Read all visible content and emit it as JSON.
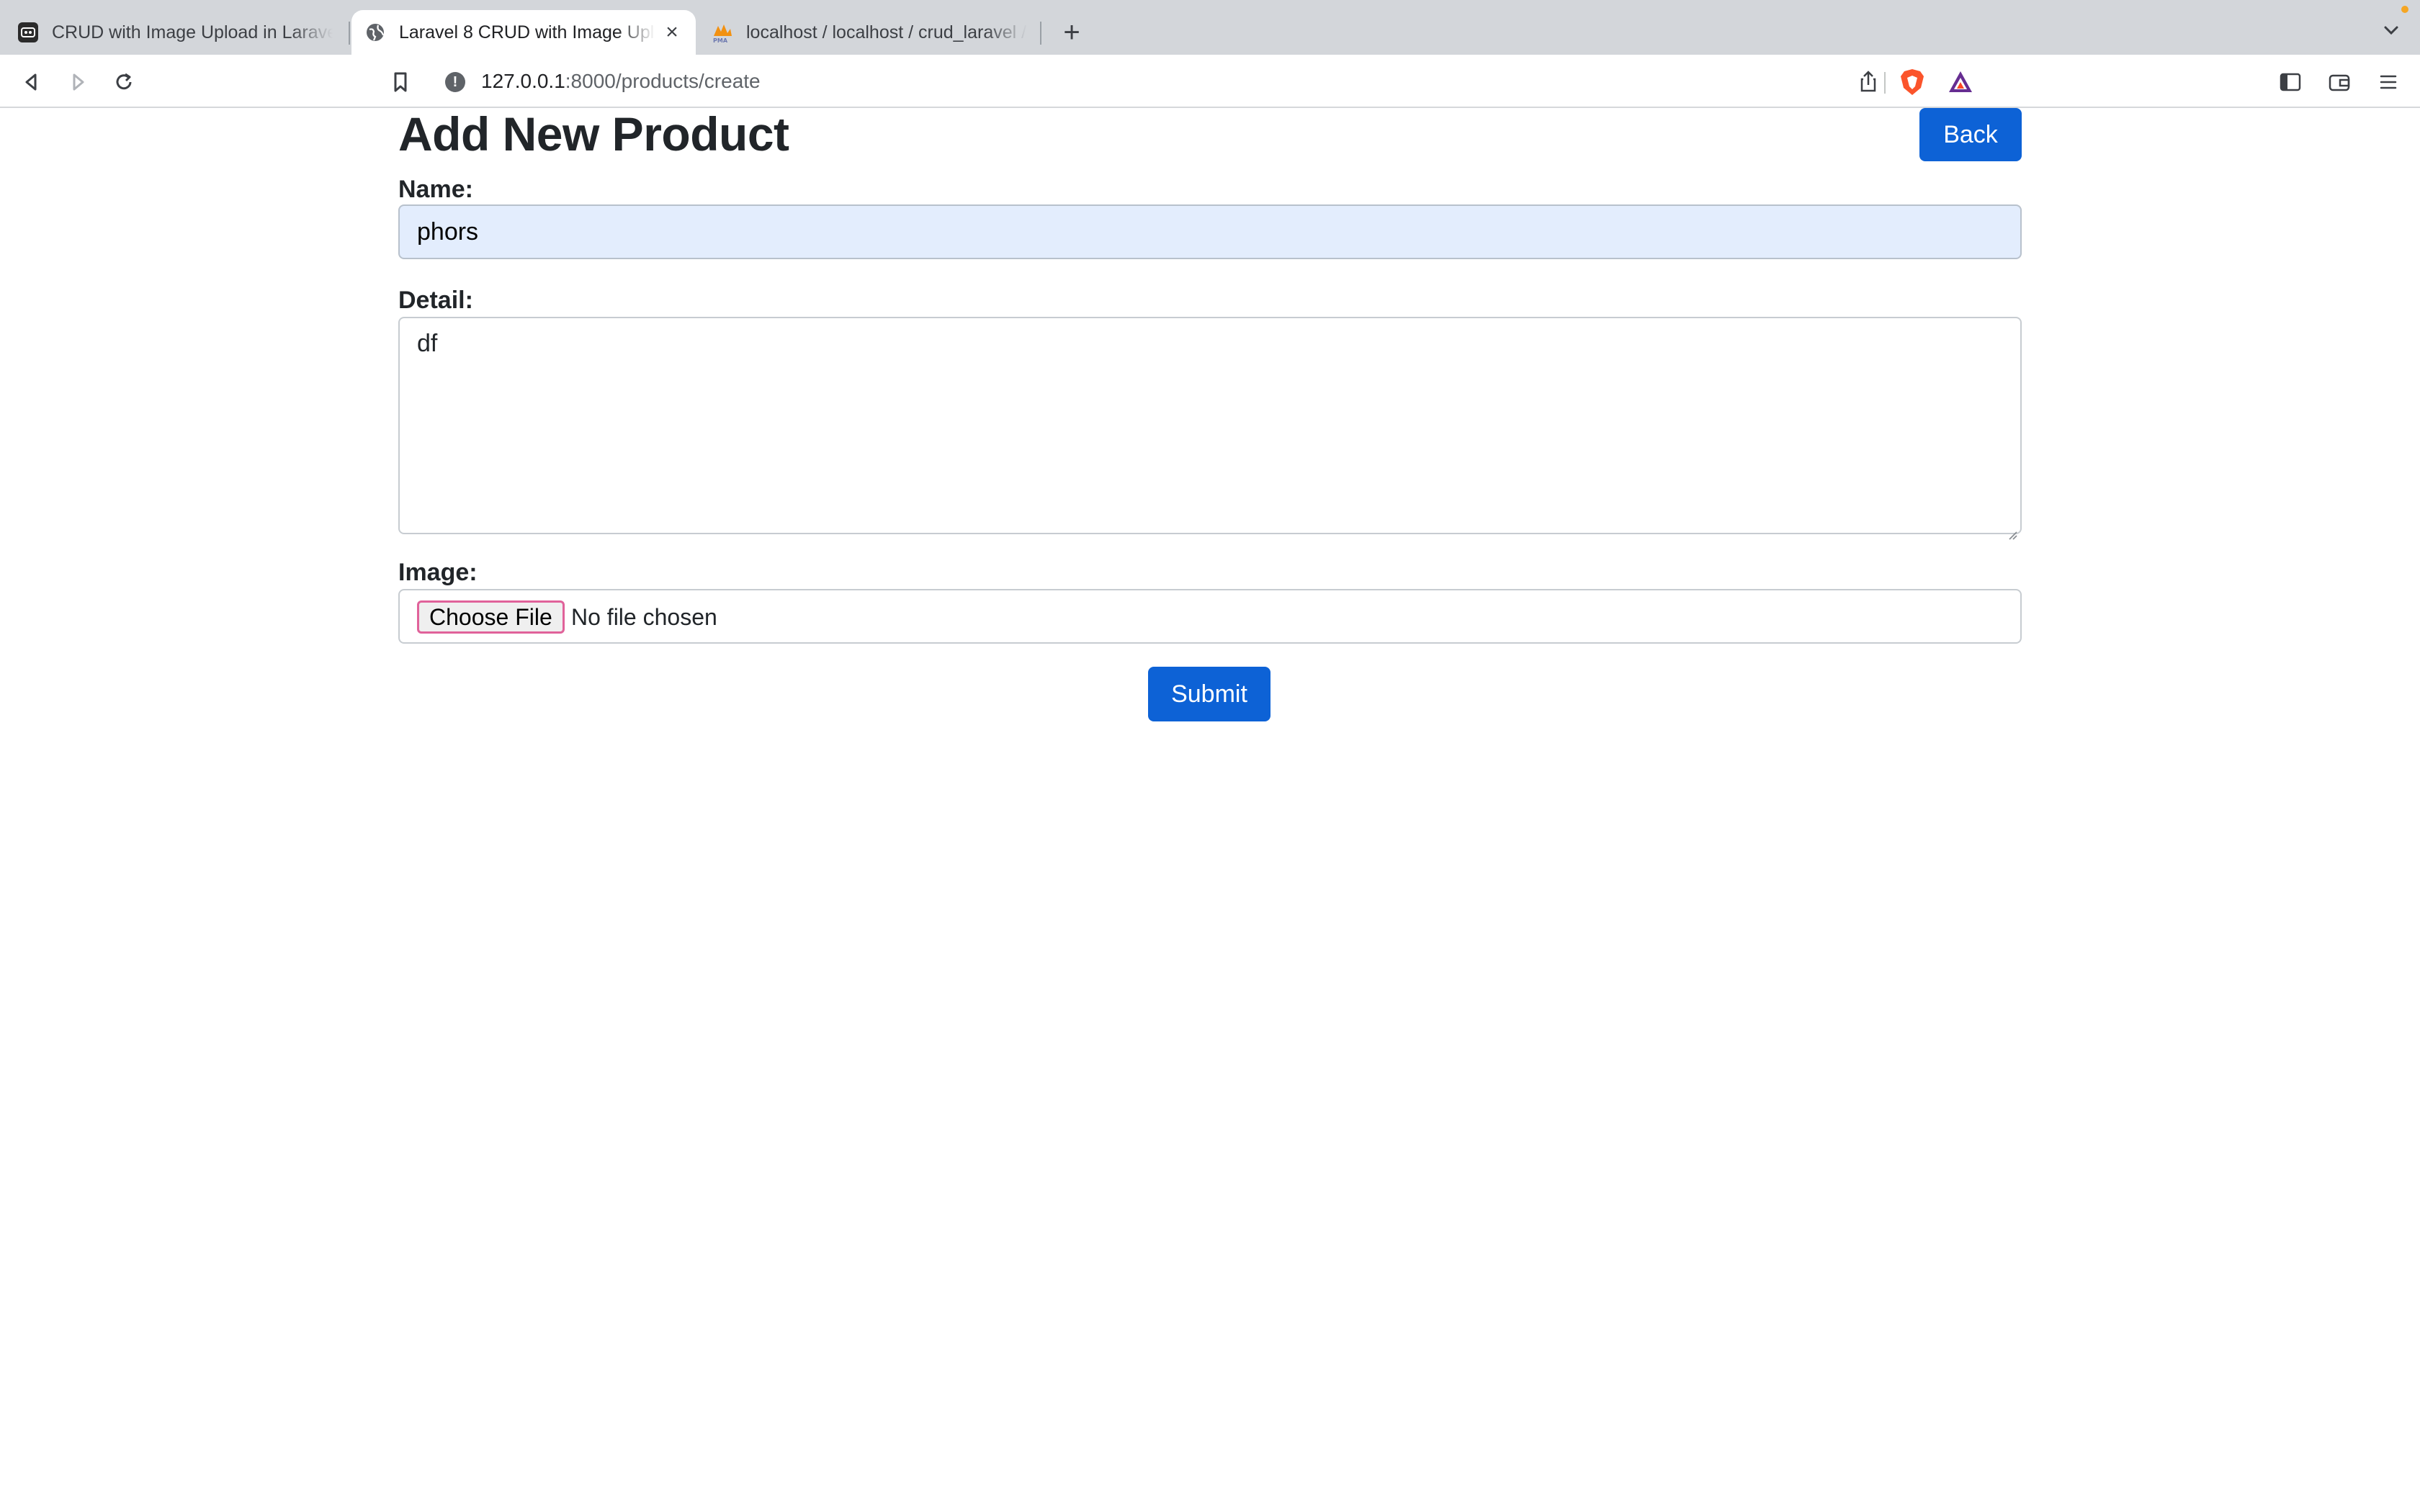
{
  "browser": {
    "tabs": [
      {
        "title": "CRUD with Image Upload in Laravel",
        "favicon": "laravel-favicon",
        "active": false
      },
      {
        "title": "Laravel 8 CRUD with Image Upload",
        "favicon": "globe-icon",
        "active": true,
        "close": "×"
      },
      {
        "title": "localhost / localhost / crud_laravel / products",
        "favicon": "phpmyadmin-favicon",
        "active": false
      }
    ],
    "new_tab": "+",
    "address": {
      "host": "127.0.0.1",
      "rest": ":8000/products/create"
    },
    "icons": [
      "back-icon",
      "forward-icon",
      "reload-icon",
      "bookmark-icon",
      "info-icon",
      "share-icon",
      "brave-shields-icon",
      "brave-rewards-icon",
      "sidebar-icon",
      "wallet-icon",
      "menu-icon",
      "tab-list-chevron-icon"
    ],
    "accent": "#f5a623"
  },
  "page": {
    "title": "Add New Product",
    "back_label": "Back",
    "name": {
      "label": "Name:",
      "value": "phors"
    },
    "detail": {
      "label": "Detail:",
      "value": "df"
    },
    "image": {
      "label": "Image:",
      "button_label": "Choose File",
      "status": "No file chosen"
    },
    "submit_label": "Submit",
    "primary_color": "#0d62d6"
  }
}
